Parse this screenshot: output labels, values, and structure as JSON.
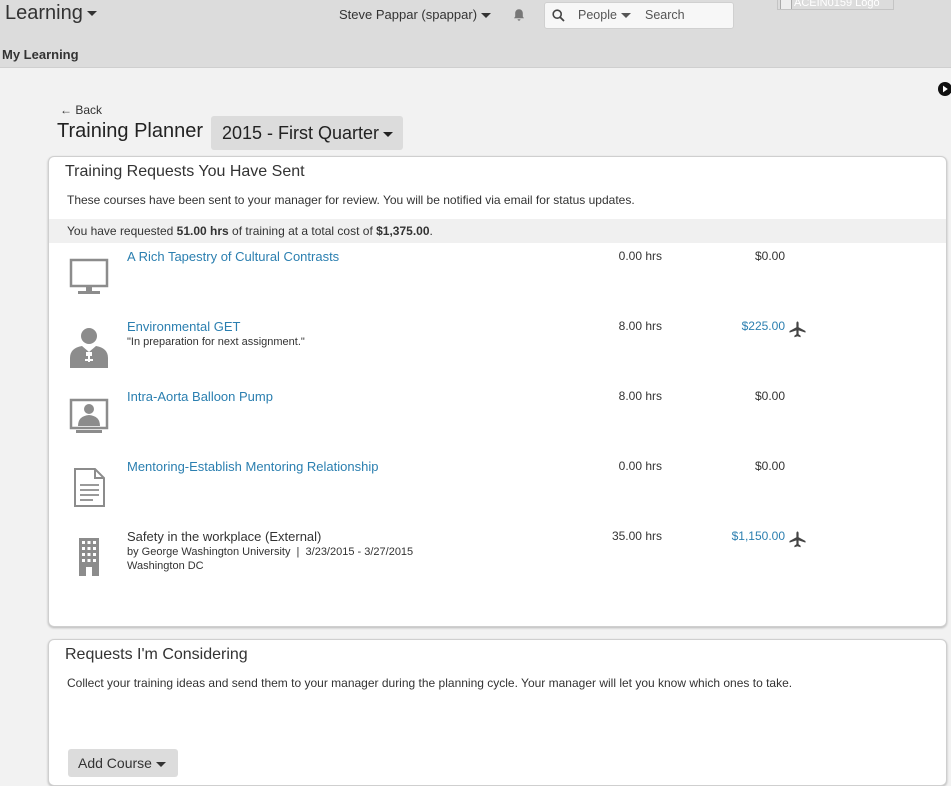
{
  "header": {
    "app_title": "Learning",
    "user_label": "Steve Pappar (spappar)",
    "search_scope": "People",
    "search_placeholder": "Search",
    "logo_alt": "ACEIN0159 Logo",
    "subnav": "My Learning"
  },
  "page": {
    "back_label": "← Back",
    "title": "Training Planner",
    "period": "2015 - First Quarter"
  },
  "sent_panel": {
    "title": "Training Requests You Have Sent",
    "description": "These courses have been sent to your manager for review. You will be notified via email for status updates.",
    "summary": {
      "prefix": "You have requested ",
      "hours": "51.00 hrs",
      "middle": " of training at a total cost of ",
      "cost": "$1,375.00",
      "suffix": "."
    },
    "courses": [
      {
        "title": "A Rich Tapestry of Cultural Contrasts",
        "icon": "monitor-icon",
        "hours": "0.00 hrs",
        "cost": "$0.00"
      },
      {
        "title": "Environmental GET",
        "icon": "instructor-icon",
        "note": "\"In preparation for next assignment.\"",
        "hours": "8.00 hrs",
        "cost": "$225.00",
        "travel_icon": "airplane-icon"
      },
      {
        "title": "Intra-Aorta Balloon Pump",
        "icon": "virtual-classroom-icon",
        "hours": "8.00 hrs",
        "cost": "$0.00"
      },
      {
        "title": "Mentoring-Establish Mentoring Relationship",
        "icon": "document-icon",
        "hours": "0.00 hrs",
        "cost": "$0.00"
      },
      {
        "title": "Safety in the workplace (External)",
        "icon": "building-icon",
        "provider_line": "by George Washington University  |  3/23/2015 - 3/27/2015",
        "location": "Washington DC",
        "hours": "35.00 hrs",
        "cost": "$1,150.00",
        "travel_icon": "airplane-icon"
      }
    ]
  },
  "considering_panel": {
    "title": "Requests I'm Considering",
    "description": "Collect your training ideas and send them to your manager during the planning cycle. Your manager will let you know which ones to take.",
    "add_button": "Add Course"
  },
  "colors": {
    "topbar": "#dcdcdc",
    "page_bg": "#f2f2f2",
    "link": "#2b7fb0",
    "text": "#333333",
    "icon_gray": "#8c8c8c"
  }
}
